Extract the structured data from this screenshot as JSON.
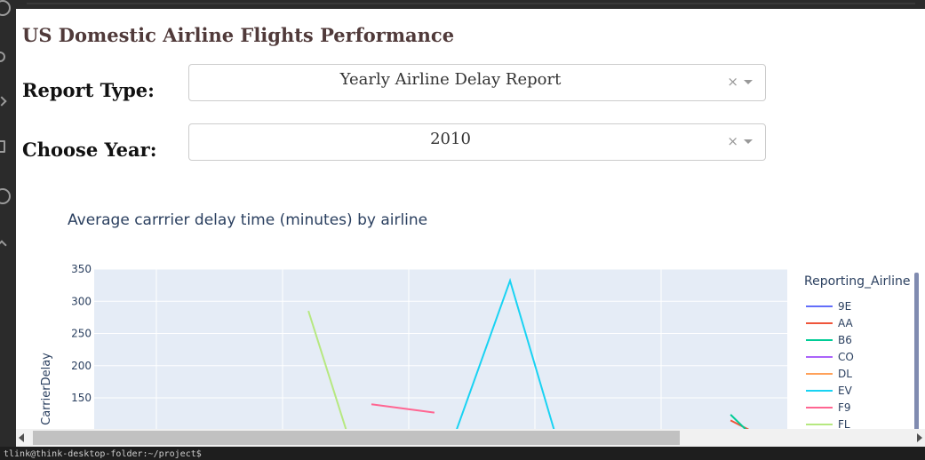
{
  "app": {
    "title": "US Domestic Airline Flights Performance"
  },
  "controls": {
    "report_type": {
      "label": "Report Type:",
      "value": "Yearly Airline Delay Report",
      "clear_symbol": "×"
    },
    "year": {
      "label": "Choose Year:",
      "value": "2010",
      "clear_symbol": "×"
    }
  },
  "status": {
    "text": "tlink@think-desktop-folder:~/project$"
  },
  "chart_data": {
    "type": "line",
    "title": "Average carrrier delay time (minutes) by airline",
    "ylabel": "CarrierDelay",
    "xlabel": "",
    "ylim": [
      125,
      350
    ],
    "xlim": [
      0,
      110
    ],
    "y_ticks": [
      150,
      200,
      250,
      300,
      350
    ],
    "y_tick_labels": [
      "150",
      "200",
      "250",
      "300",
      "350"
    ],
    "grid": true,
    "plot_bgcolor": "#e5ecf6",
    "legend": {
      "title": "Reporting_Airline",
      "placement": "right",
      "entries": [
        "9E",
        "AA",
        "B6",
        "CO",
        "DL",
        "EV",
        "F9",
        "FL"
      ]
    },
    "series": [
      {
        "name": "9E",
        "color": "#636efa",
        "x": [],
        "y": []
      },
      {
        "name": "AA",
        "color": "#ef553b",
        "x": [
          101,
          104
        ],
        "y": [
          115,
          100
        ]
      },
      {
        "name": "B6",
        "color": "#00cc96",
        "x": [
          101,
          103.5
        ],
        "y": [
          124,
          100
        ]
      },
      {
        "name": "CO",
        "color": "#ab63fa",
        "x": [],
        "y": []
      },
      {
        "name": "DL",
        "color": "#ffa15a",
        "x": [],
        "y": []
      },
      {
        "name": "EV",
        "color": "#19d3f3",
        "x": [
          57.5,
          66,
          73
        ],
        "y": [
          100,
          332,
          100
        ]
      },
      {
        "name": "F9",
        "color": "#ff6692",
        "x": [
          44,
          54
        ],
        "y": [
          140,
          127
        ]
      },
      {
        "name": "FL",
        "color": "#b6e880",
        "x": [
          34,
          40
        ],
        "y": [
          285,
          100
        ]
      }
    ]
  }
}
